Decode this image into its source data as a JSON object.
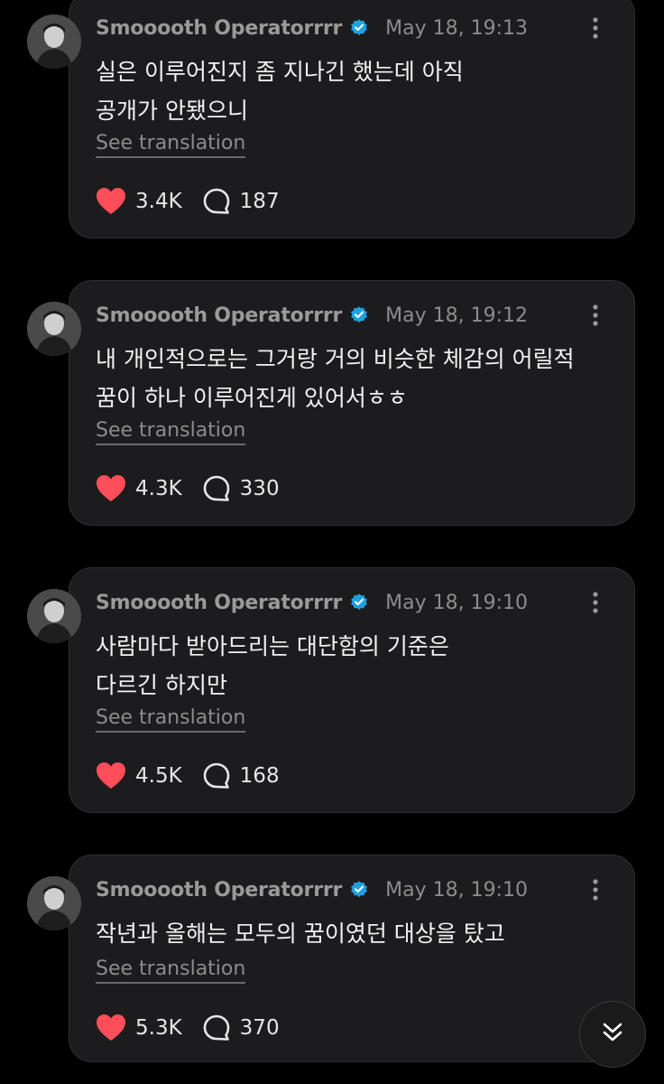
{
  "posts": [
    {
      "username": "Smooooth Operatorrrr",
      "timestamp": "May 18, 19:13",
      "text": "실은 이루어진지 좀 지나긴 했는데 아직\n공개가 안됐으니",
      "translation_label": "See translation",
      "likes": "3.4K",
      "replies": "187"
    },
    {
      "username": "Smooooth Operatorrrr",
      "timestamp": "May 18, 19:12",
      "text": "내 개인적으로는 그거랑 거의 비슷한 체감의 어릴적\n꿈이 하나 이루어진게 있어서ㅎㅎ",
      "translation_label": "See translation",
      "likes": "4.3K",
      "replies": "330"
    },
    {
      "username": "Smooooth Operatorrrr",
      "timestamp": "May 18, 19:10",
      "text": "사람마다 받아드리는 대단함의 기준은\n다르긴 하지만",
      "translation_label": "See translation",
      "likes": "4.5K",
      "replies": "168"
    },
    {
      "username": "Smooooth Operatorrrr",
      "timestamp": "May 18, 19:10",
      "text": "작년과 올해는 모두의 꿈이였던 대상을 탔고",
      "translation_label": "See translation",
      "likes": "5.3K",
      "replies": "370"
    }
  ],
  "icons": {
    "verified": "verified-badge-icon",
    "more": "more-vertical-icon",
    "like": "heart-icon",
    "reply": "speech-bubble-icon",
    "scroll": "double-chevron-down-icon"
  },
  "colors": {
    "background": "#000000",
    "card": "#1c1c1e",
    "heart": "#ff4d5a",
    "verified": "#1fa1e0",
    "text": "#f2f2f2",
    "muted": "#8c8c8c"
  }
}
